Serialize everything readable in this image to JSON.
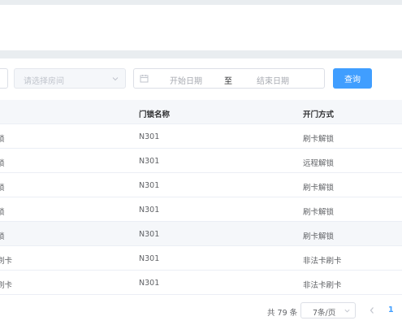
{
  "filters": {
    "room_placeholder": "请选择房间",
    "start_placeholder": "开始日期",
    "range_separator": "至",
    "end_placeholder": "结束日期",
    "query_label": "查询"
  },
  "table": {
    "headers": [
      "",
      "门锁名称",
      "开门方式"
    ],
    "rows": [
      {
        "col0": "锁",
        "lock": "N301",
        "method": "刷卡解锁"
      },
      {
        "col0": "锁",
        "lock": "N301",
        "method": "远程解锁"
      },
      {
        "col0": "锁",
        "lock": "N301",
        "method": "刷卡解锁"
      },
      {
        "col0": "锁",
        "lock": "N301",
        "method": "刷卡解锁"
      },
      {
        "col0": "锁",
        "lock": "N301",
        "method": "刷卡解锁"
      },
      {
        "col0": "刷卡",
        "lock": "N301",
        "method": "非法卡刷卡"
      },
      {
        "col0": "刷卡",
        "lock": "N301",
        "method": "非法卡刷卡"
      }
    ]
  },
  "pagination": {
    "total_text": "共 79 条",
    "page_size": "7条/页",
    "current_page": "1"
  },
  "icons": {
    "room_select_chevron": "chevron-down-icon",
    "calendar": "calendar-icon",
    "page_size_chevron": "chevron-down-icon",
    "prev_page": "chevron-left-icon"
  },
  "colors": {
    "primary": "#409eff",
    "header_bg": "#f5f7fa"
  }
}
